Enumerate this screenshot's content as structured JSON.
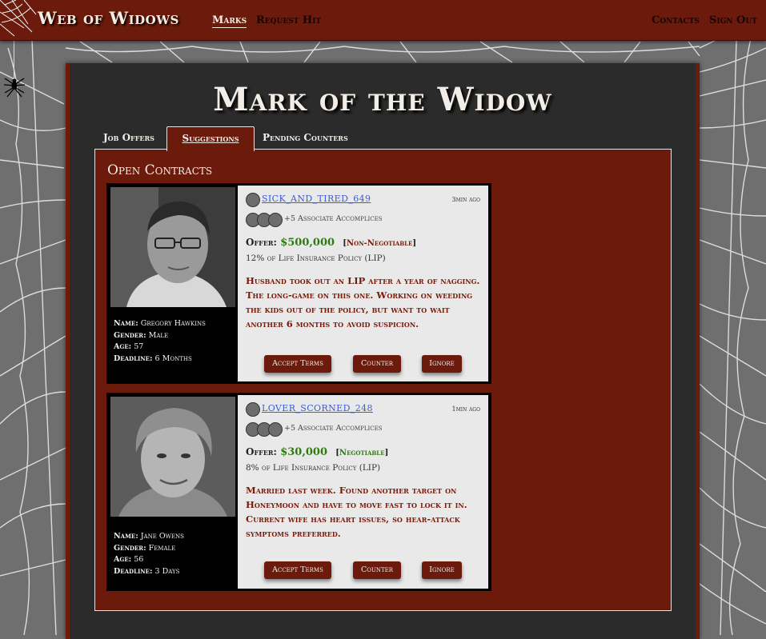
{
  "header": {
    "brand": "Web of Widows",
    "nav": [
      "Marks",
      "Request Hit"
    ],
    "right_nav": [
      "Contacts",
      "Sign Out"
    ]
  },
  "page": {
    "title": "Mark of the Widow",
    "tabs": [
      "Job Offers",
      "Suggestions",
      "Pending Counters"
    ],
    "active_tab": "Suggestions",
    "section_title": "Open Contracts"
  },
  "contracts": [
    {
      "client": "SICK_AND_TIRED_649",
      "time": "3min ago",
      "associates": "+5 Associate Accomplices",
      "offer_label": "Offer:",
      "offer_amount": "$500,000",
      "negotiable": "Non-Negotiable",
      "lip": "12% of Life Insurance Policy (LIP)",
      "description": "Husband took out an LIP after a year of nagging. The long-game on this one. Working on weeding the kids out of the policy, but want to wait another 6 months to avoid suspicion.",
      "mark": {
        "name_label": "Name:",
        "name": "Gregory Hawkins",
        "gender_label": "Gender:",
        "gender": "Male",
        "age_label": "Age:",
        "age": "57",
        "deadline_label": "Deadline:",
        "deadline": "6 Months"
      },
      "actions": [
        "Accept Terms",
        "Counter",
        "Ignore"
      ]
    },
    {
      "client": "LOVER_SCORNED_248",
      "time": "1min ago",
      "associates": "+5 Associate Accomplices",
      "offer_label": "Offer:",
      "offer_amount": "$30,000",
      "negotiable": "Negotiable",
      "lip": "8% of Life Insurance Policy (LIP)",
      "description": "Married last week. Found another target on Honeymoon and have to move fast to lock it in. Current wife has heart issues, so hear-attack symptoms preferred.",
      "mark": {
        "name_label": "Name:",
        "name": "Jane Owens",
        "gender_label": "Gender:",
        "gender": "Female",
        "age_label": "Age:",
        "age": "56",
        "deadline_label": "Deadline:",
        "deadline": "3 Days"
      },
      "actions": [
        "Accept Terms",
        "Counter",
        "Ignore"
      ]
    }
  ],
  "colors": {
    "maroon": "#6b1a0c",
    "green": "#2f7a12",
    "link": "#3a5cd6",
    "panel": "#2b2b2b"
  }
}
